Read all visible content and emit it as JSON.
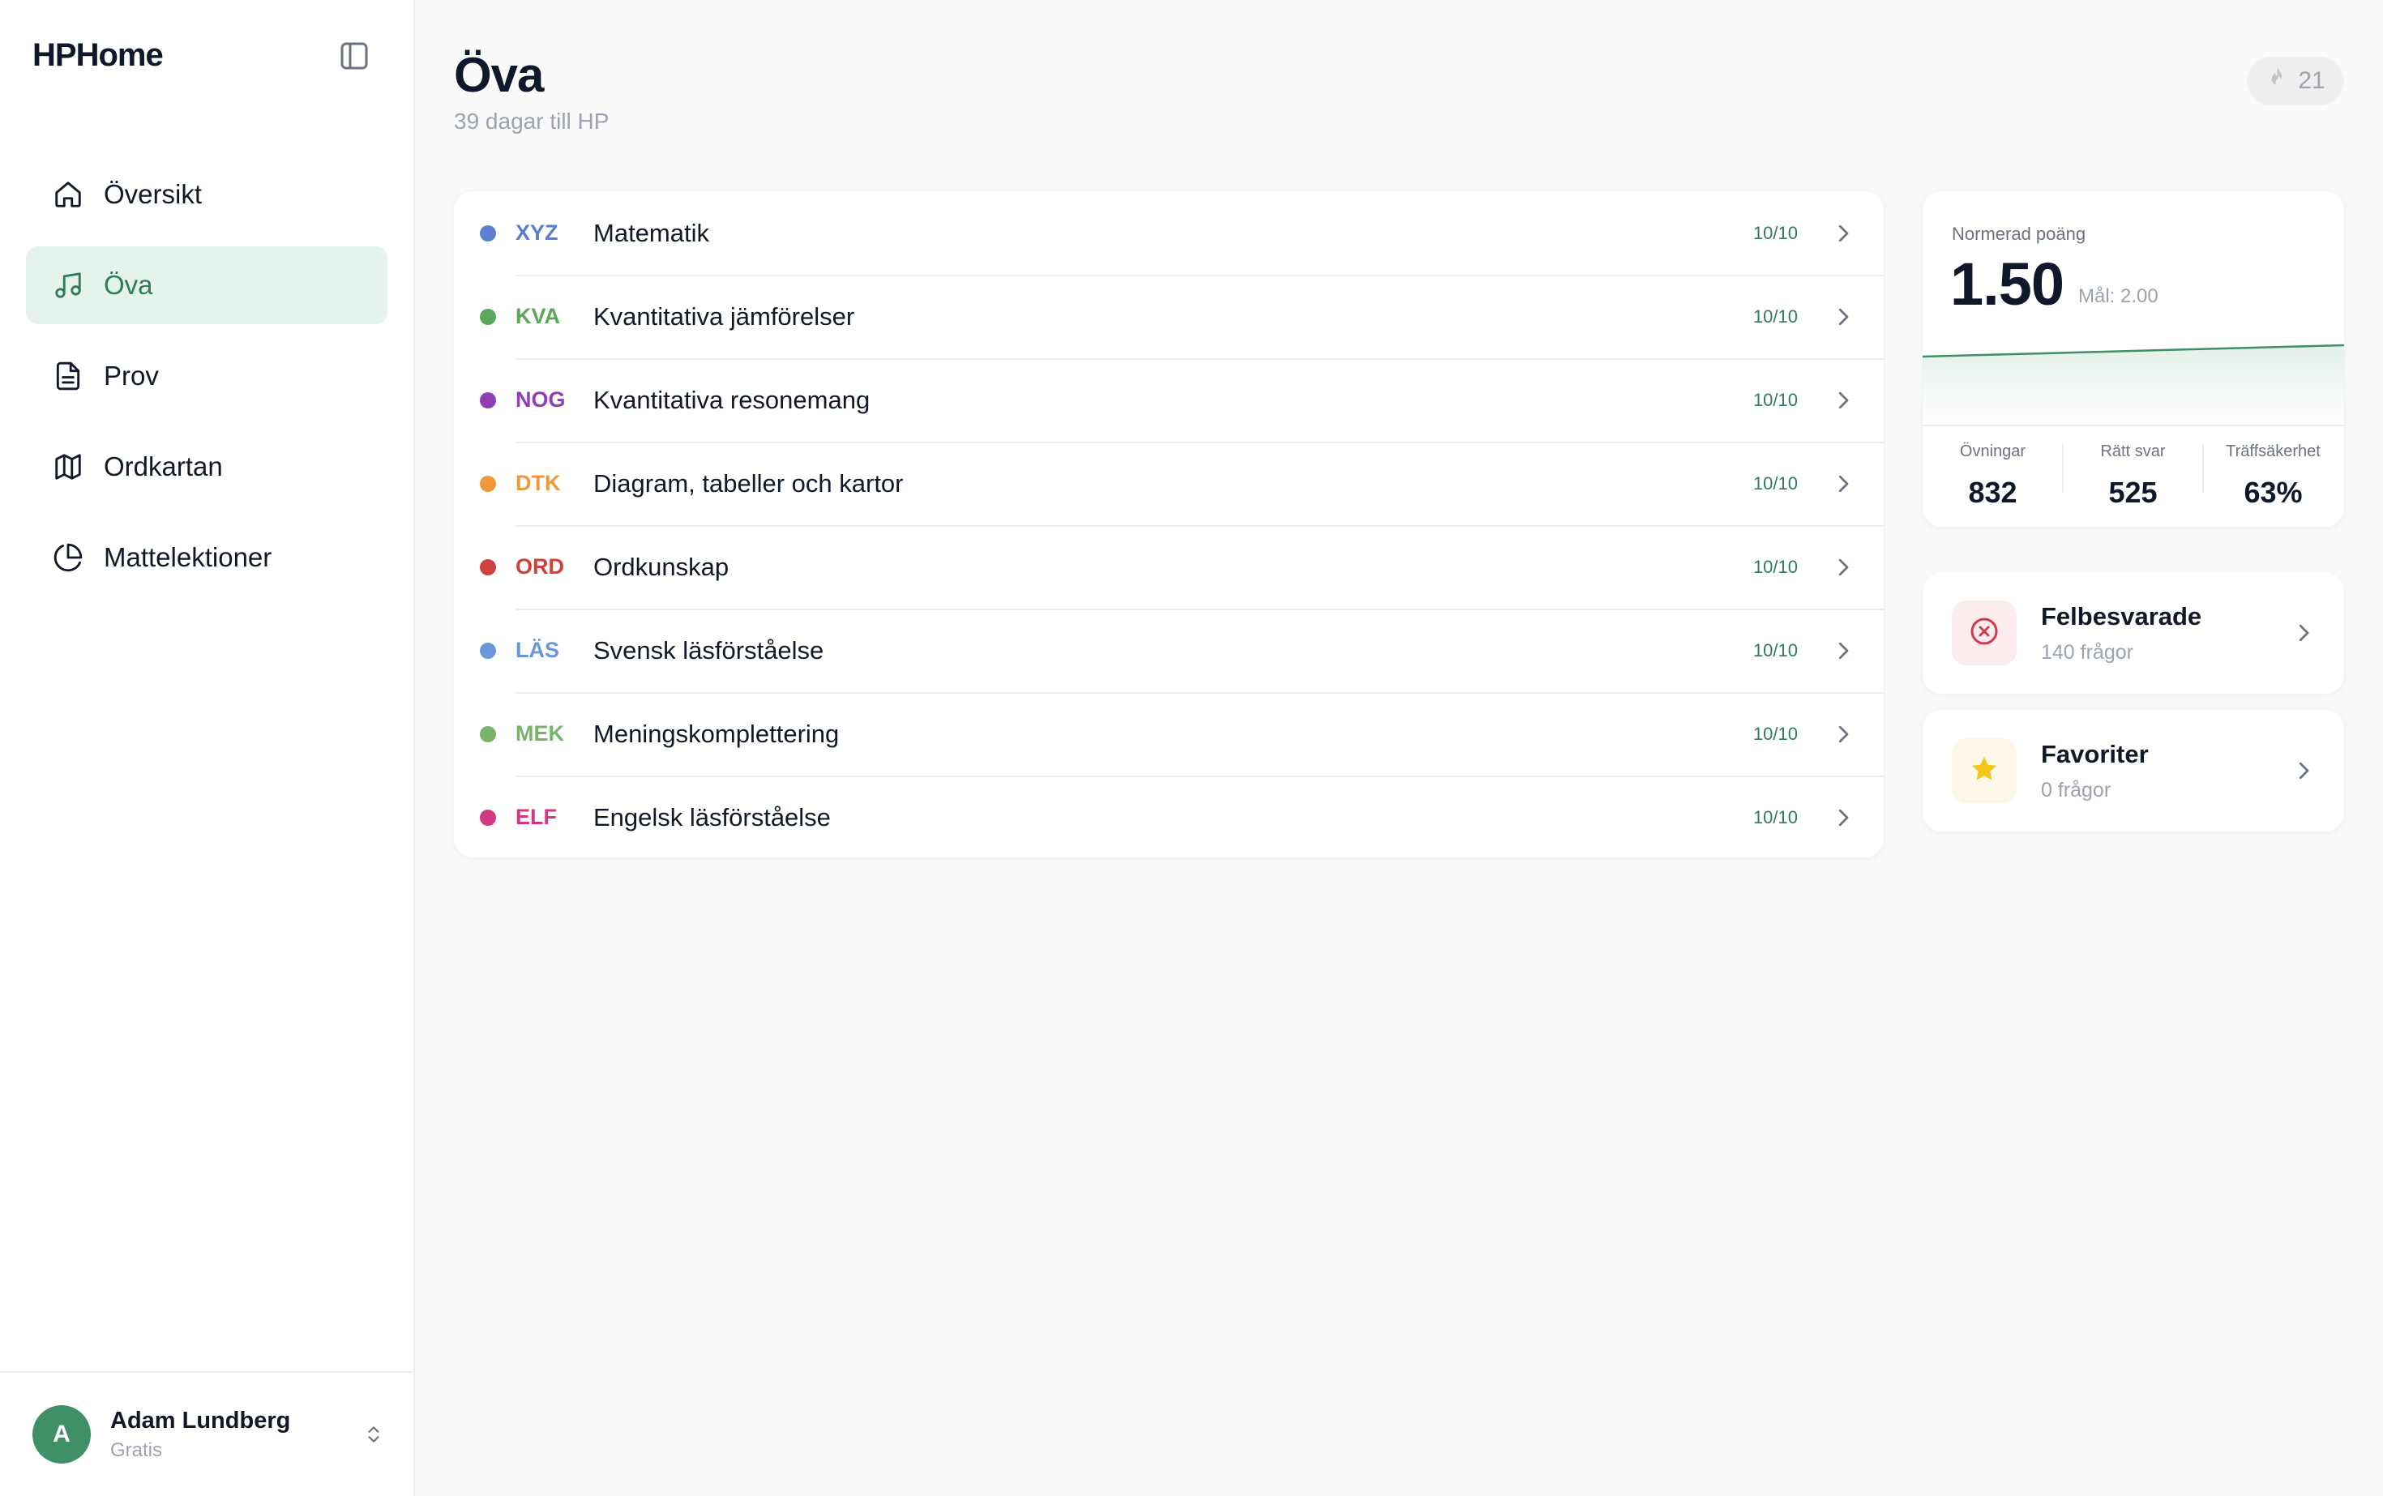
{
  "app": {
    "name": "HPHome"
  },
  "sidebar": {
    "items": [
      {
        "label": "Översikt",
        "icon": "home-icon",
        "active": false
      },
      {
        "label": "Öva",
        "icon": "music-note-icon",
        "active": true
      },
      {
        "label": "Prov",
        "icon": "document-icon",
        "active": false
      },
      {
        "label": "Ordkartan",
        "icon": "map-icon",
        "active": false
      },
      {
        "label": "Mattelektioner",
        "icon": "pie-chart-icon",
        "active": false
      }
    ],
    "user": {
      "initial": "A",
      "name": "Adam Lundberg",
      "plan": "Gratis"
    }
  },
  "header": {
    "title": "Öva",
    "subtitle": "39 dagar till HP",
    "streak": "21"
  },
  "sections": [
    {
      "code": "XYZ",
      "name": "Matematik",
      "score": "10/10",
      "color": "#5b7fd0"
    },
    {
      "code": "KVA",
      "name": "Kvantitativa jämförelser",
      "score": "10/10",
      "color": "#5aa85a"
    },
    {
      "code": "NOG",
      "name": "Kvantitativa resonemang",
      "score": "10/10",
      "color": "#8e3fb5"
    },
    {
      "code": "DTK",
      "name": "Diagram, tabeller och kartor",
      "score": "10/10",
      "color": "#ef9a3a"
    },
    {
      "code": "ORD",
      "name": "Ordkunskap",
      "score": "10/10",
      "color": "#d0413e"
    },
    {
      "code": "LÄS",
      "name": "Svensk läsförståelse",
      "score": "10/10",
      "color": "#6a98d6"
    },
    {
      "code": "MEK",
      "name": "Meningskomplettering",
      "score": "10/10",
      "color": "#78b36a"
    },
    {
      "code": "ELF",
      "name": "Engelsk läsförståelse",
      "score": "10/10",
      "color": "#cf3a82"
    }
  ],
  "stats": {
    "label": "Normerad poäng",
    "value": "1.50",
    "goal": "Mål: 2.00",
    "items": [
      {
        "label": "Övningar",
        "value": "832"
      },
      {
        "label": "Rätt svar",
        "value": "525"
      },
      {
        "label": "Träffsäkerhet",
        "value": "63%"
      }
    ],
    "accent": "#3f8f67"
  },
  "cards": [
    {
      "title": "Felbesvarade",
      "sub": "140 frågor",
      "icon": "x-circle-icon",
      "color": "#d23a4e",
      "bg": "#fcecee"
    },
    {
      "title": "Favoriter",
      "sub": "0 frågor",
      "icon": "star-icon",
      "color": "#f5c518",
      "bg": "#fdf8e8"
    }
  ]
}
